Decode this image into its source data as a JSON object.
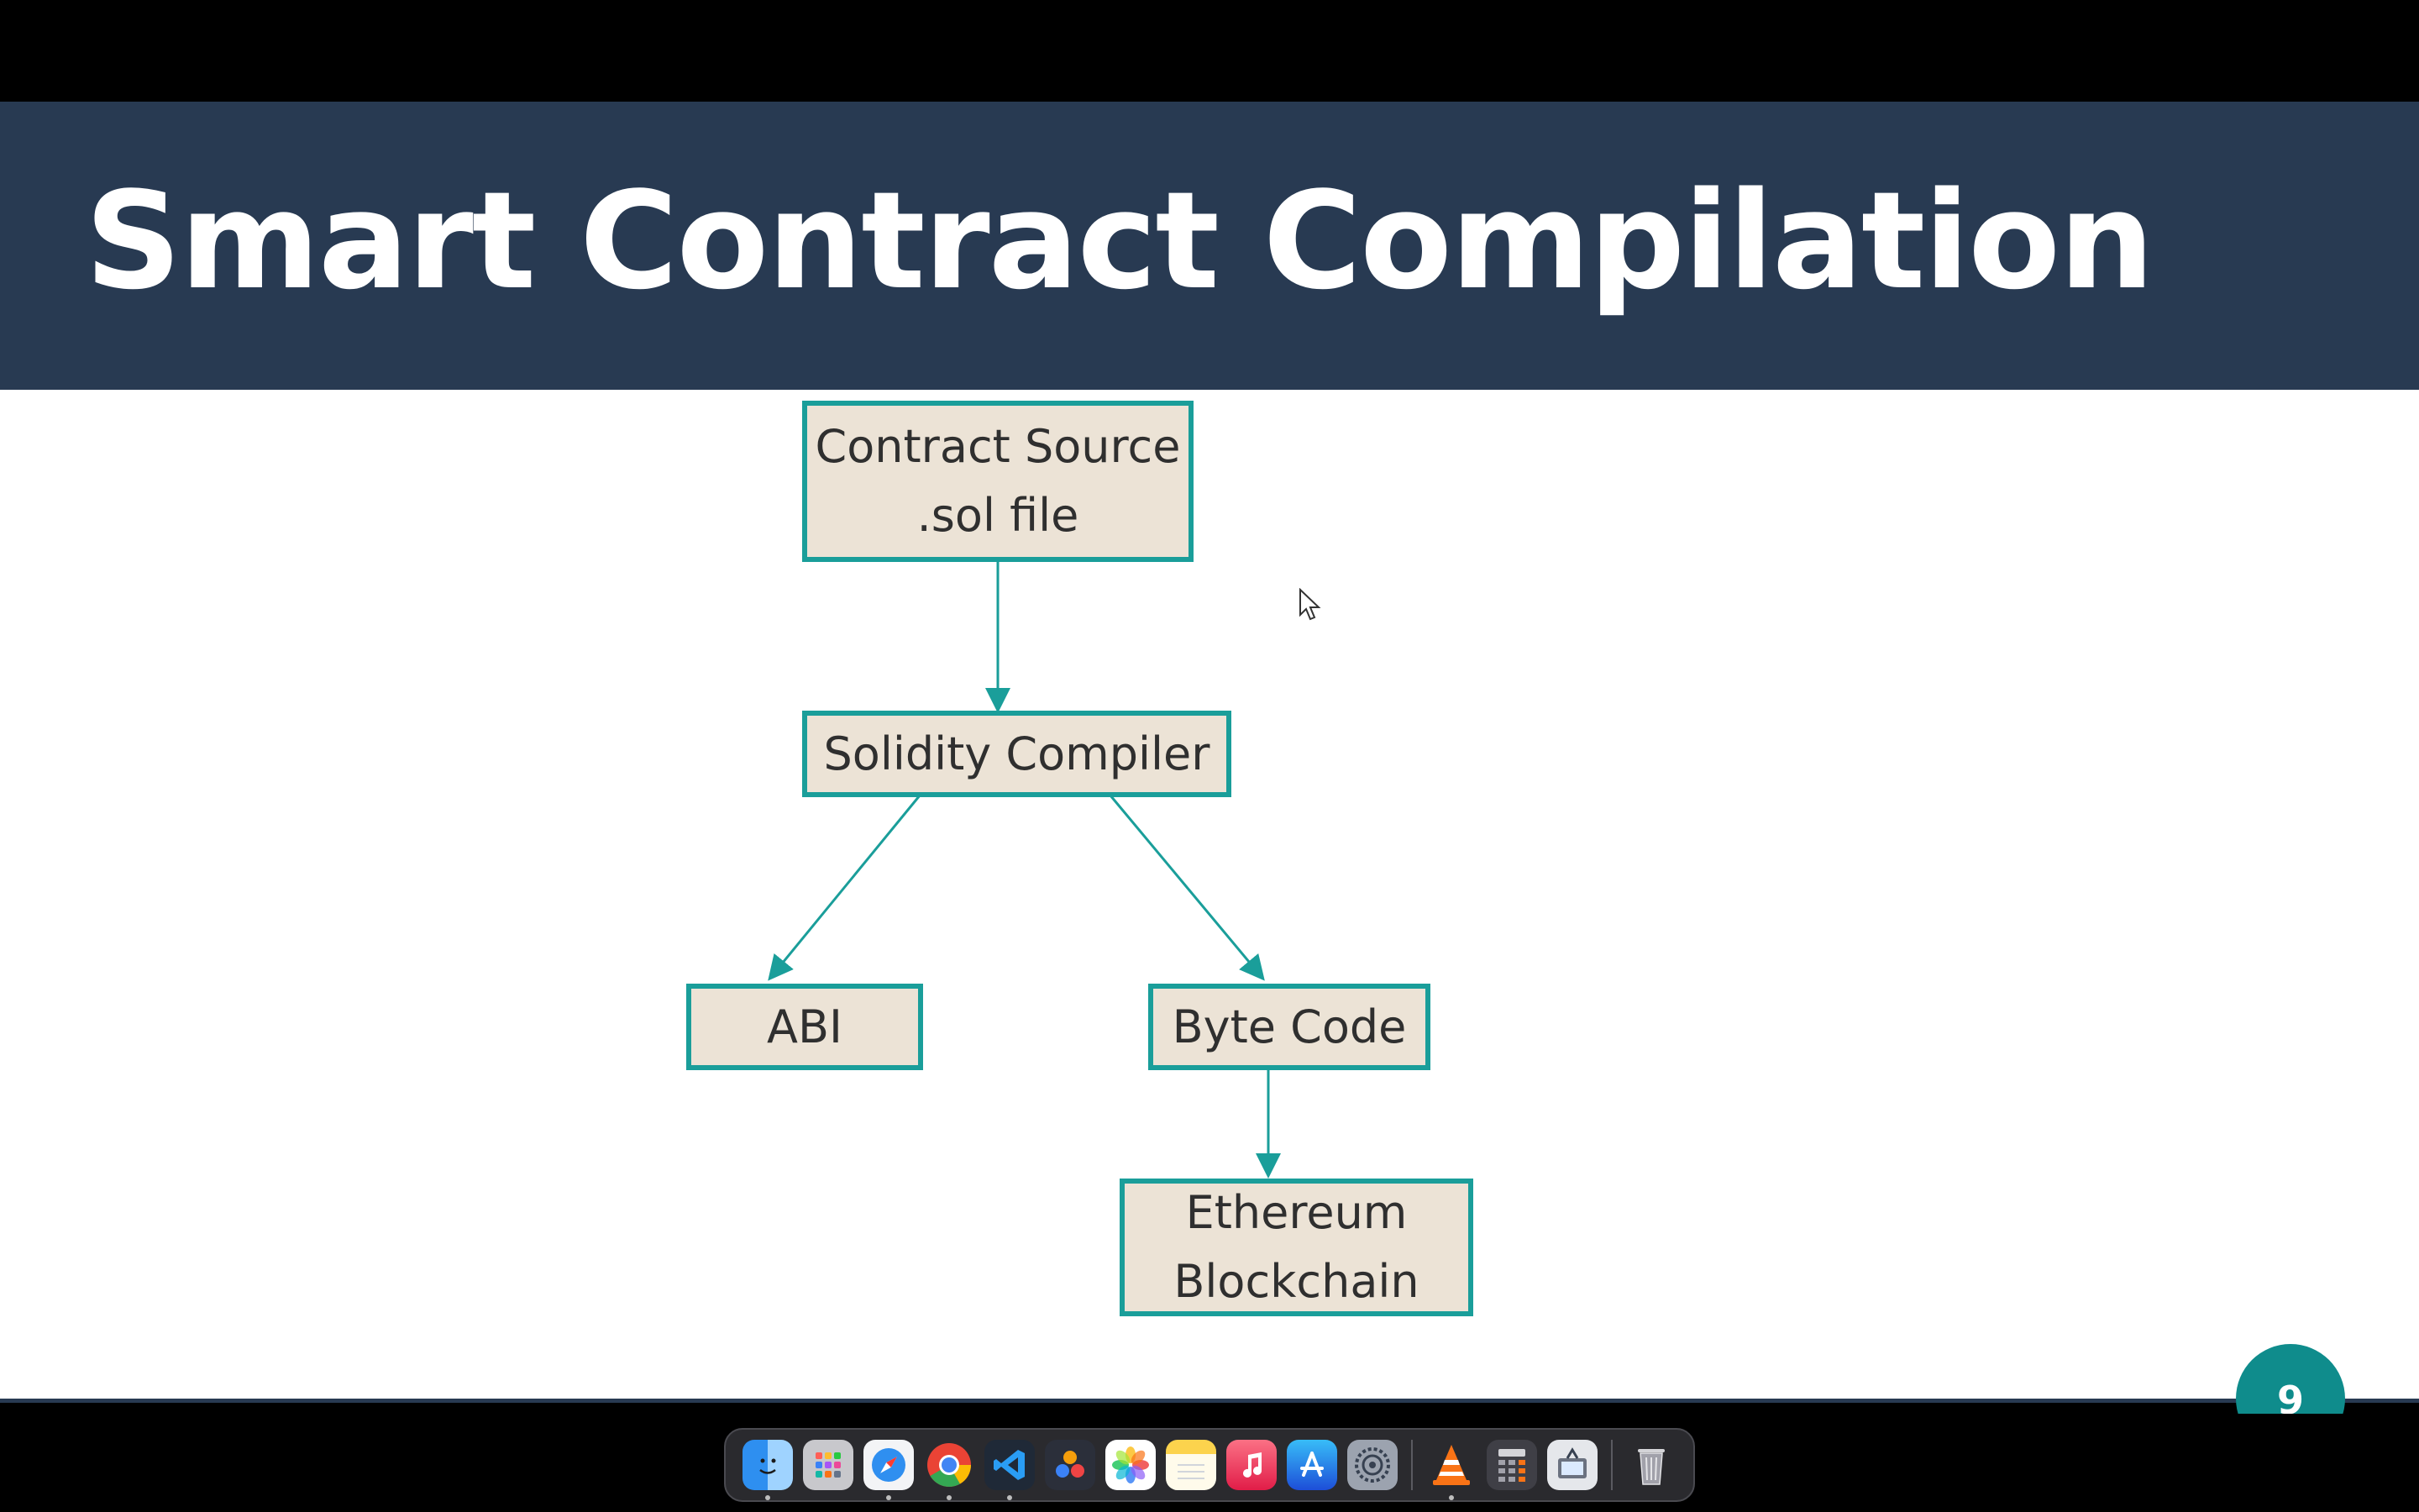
{
  "slide": {
    "title": "Smart Contract Compilation",
    "page_number": "9"
  },
  "diagram": {
    "nodes": {
      "contract_source": {
        "line1": "Contract Source",
        "line2": ".sol file"
      },
      "solidity_compiler": {
        "line1": "Solidity Compiler"
      },
      "abi": {
        "line1": "ABI"
      },
      "byte_code": {
        "line1": "Byte Code"
      },
      "ethereum_blockchain": {
        "line1": "Ethereum",
        "line2": "Blockchain"
      }
    }
  },
  "colors": {
    "title_bar": "#283a52",
    "node_fill": "#ece3d6",
    "node_border": "#1a9e9a",
    "badge": "#0f8c8c"
  },
  "dock": {
    "items": [
      {
        "name": "finder-icon",
        "running": true
      },
      {
        "name": "launchpad-icon",
        "running": false
      },
      {
        "name": "safari-icon",
        "running": true
      },
      {
        "name": "chrome-icon",
        "running": true
      },
      {
        "name": "vscode-icon",
        "running": true
      },
      {
        "name": "davinci-resolve-icon",
        "running": false
      },
      {
        "name": "photos-icon",
        "running": false
      },
      {
        "name": "notes-icon",
        "running": false
      },
      {
        "name": "music-icon",
        "running": false
      },
      {
        "name": "app-store-icon",
        "running": false
      },
      {
        "name": "system-settings-icon",
        "running": false
      },
      {
        "name": "vlc-icon",
        "running": true
      },
      {
        "name": "calculator-icon",
        "running": false
      },
      {
        "name": "preview-icon",
        "running": false
      },
      {
        "name": "trash-icon",
        "running": false
      }
    ]
  }
}
